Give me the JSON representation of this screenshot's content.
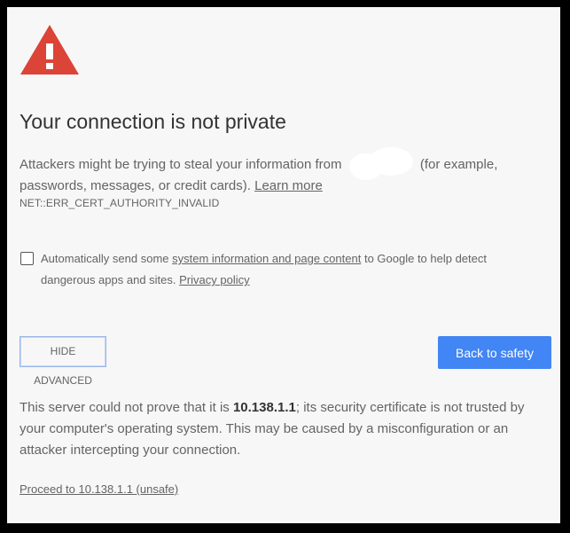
{
  "warning": {
    "icon": "warning-triangle-icon",
    "color": "#db4437"
  },
  "title": "Your connection is not private",
  "intro": {
    "before": "Attackers might be trying to steal your information from",
    "after": "(for example, passwords, messages, or credit cards).",
    "learn_more": "Learn more"
  },
  "error_code": "NET::ERR_CERT_AUTHORITY_INVALID",
  "report": {
    "checked": false,
    "before": "Automatically send some",
    "link": "system information and page content",
    "after": "to Google to help detect dangerous apps and sites.",
    "privacy_link": "Privacy policy"
  },
  "buttons": {
    "hide_advanced": "HIDE ADVANCED",
    "back_to_safety": "Back to safety",
    "primary_color": "#4285f4"
  },
  "details": {
    "before": "This server could not prove that it is",
    "host": "10.138.1.1",
    "after": "; its security certificate is not trusted by your computer's operating system. This may be caused by a misconfiguration or an attacker intercepting your connection."
  },
  "proceed_link": "Proceed to 10.138.1.1 (unsafe)"
}
